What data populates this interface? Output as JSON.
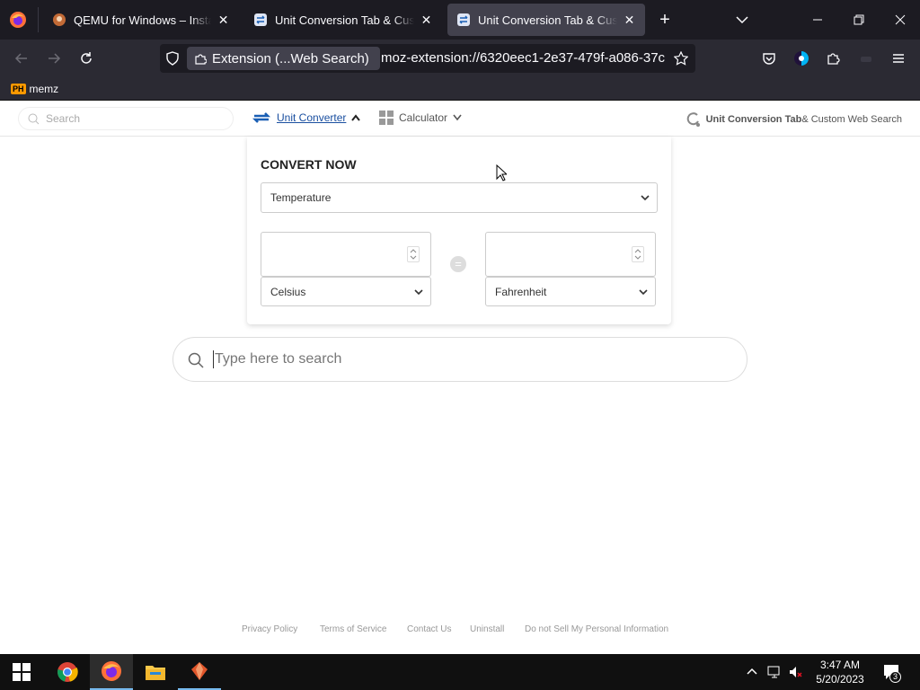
{
  "tabs": [
    {
      "title": "QEMU for Windows – Installe",
      "active": false
    },
    {
      "title": "Unit Conversion Tab & Custom",
      "active": false
    },
    {
      "title": "Unit Conversion Tab & Custom",
      "active": true
    }
  ],
  "urlbar": {
    "identity_label": "Extension (...Web Search)",
    "url": "moz-extension://6320eec1-2e37-479f-a086-37c"
  },
  "bookmarks": [
    {
      "badge": "PH",
      "label": "memz"
    }
  ],
  "header": {
    "search_placeholder": "Search",
    "unit_converter_label": "Unit Converter",
    "calculator_label": "Calculator",
    "brand_bold": "Unit Conversion Tab",
    "brand_rest": " & Custom Web Search"
  },
  "converter": {
    "title": "CONVERT NOW",
    "category": "Temperature",
    "from_value": "",
    "to_value": "",
    "from_unit": "Celsius",
    "to_unit": "Fahrenheit",
    "equals_symbol": "="
  },
  "search": {
    "placeholder": "Type here to search"
  },
  "footer": {
    "privacy": "Privacy Policy",
    "terms": "Terms of Service",
    "contact": "Contact Us",
    "uninstall": "Uninstall",
    "do_not_sell": "Do not Sell My Personal Information"
  },
  "taskbar": {
    "time": "3:47 AM",
    "date": "5/20/2023",
    "notification_count": "3"
  },
  "colors": {
    "accent": "#1a5fb4",
    "chrome_dark": "#1c1b22",
    "chrome_mid": "#2b2a33",
    "taskbar": "#101010"
  }
}
